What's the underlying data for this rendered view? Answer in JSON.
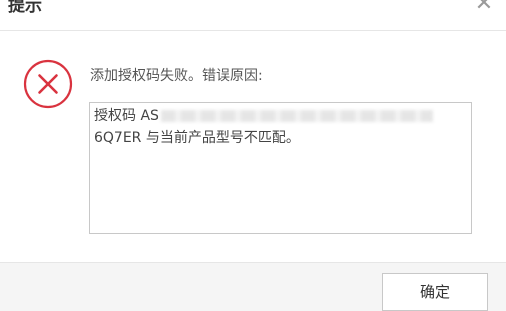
{
  "dialog": {
    "title": "提示",
    "close_icon": "close-icon",
    "status_icon": "error-circle-x-icon",
    "accent_color": "#d9333f",
    "message": "添加授权码失败。错误原因:",
    "detail_line1_prefix": "授权码 AS",
    "detail_line2": "6Q7ER 与当前产品型号不匹配。",
    "ok_label": "确定"
  }
}
